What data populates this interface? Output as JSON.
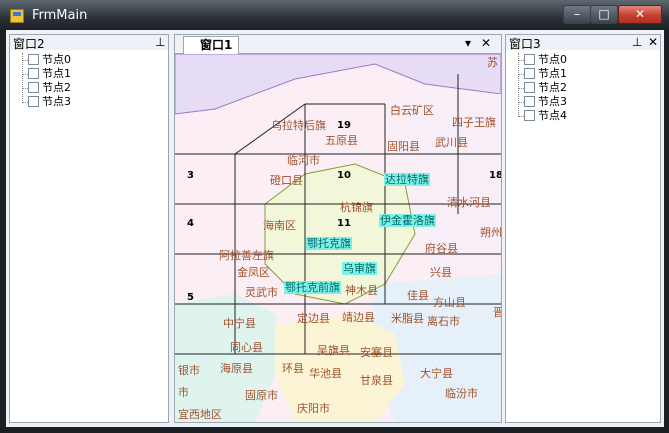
{
  "window": {
    "title": "FrmMain",
    "min": "–",
    "max": "□",
    "close": "✕"
  },
  "left_panel": {
    "title": "窗口2",
    "pin": "⊥",
    "nodes": [
      "节点0",
      "节点1",
      "节点2",
      "节点3"
    ]
  },
  "right_panel": {
    "title": "窗口3",
    "pin": "⊥",
    "close": "✕",
    "nodes": [
      "节点0",
      "节点1",
      "节点2",
      "节点3",
      "节点4"
    ]
  },
  "document": {
    "tab": "窗口1",
    "menu": "▾",
    "close": "✕"
  },
  "map": {
    "grid_numbers": [
      "19",
      "3",
      "10",
      "4",
      "11",
      "5",
      "18"
    ],
    "places": [
      "苏",
      "白云矿区",
      "乌拉特后旗",
      "四子王旗",
      "五原县",
      "固阳县",
      "武川县",
      "临河市",
      "磴口县",
      "杭锦旗",
      "清水河县",
      "海南区",
      "朔州",
      "阿拉善左旗",
      "府谷县",
      "金凤区",
      "兴县",
      "灵武市",
      "佳县",
      "方山县",
      "中宁县",
      "定边县",
      "靖边县",
      "米脂县",
      "离石市",
      "晋",
      "同心县",
      "吴旗县",
      "安塞县",
      "银市",
      "海原县",
      "环县",
      "华池县",
      "甘泉县",
      "大宁县",
      "市",
      "固原市",
      "临汾市",
      "宜西地区",
      "庆阳市",
      "神木县",
      "鄂托克旗",
      "乌审旗",
      "鄂托克前旗",
      "达拉特旗",
      "伊金霍洛旗"
    ],
    "highlights": [
      "达拉特旗",
      "伊金霍洛旗",
      "鄂托克旗",
      "乌审旗",
      "鄂托克前旗"
    ]
  }
}
